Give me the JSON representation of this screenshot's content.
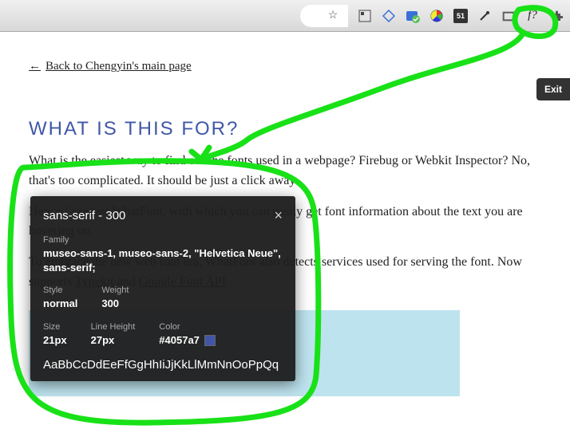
{
  "toolbar": {
    "star_icon": "☆",
    "ext_font": "f?"
  },
  "exit_label": "Exit",
  "back_link": {
    "arrow": "←",
    "text": "Back to Chengyin's main page"
  },
  "heading": "WHAT IS THIS FOR?",
  "para1_a": "What is the easiest way to find out the fonts used in a webpage? Firebug or Webkit Inspector? No, that's too complicated. It should be just a click away.",
  "para2": "Hence I present WhatFont, with which you can easily get font information about the text you are hovering on.",
  "para3_a": "To embrace the new web font era, WhatFont also detects services used for serving the font. Now supports ",
  "para3_link1": "Typekit",
  "para3_b": " and ",
  "para3_link2": "Google Font API",
  "para3_c": ".",
  "tooltip": {
    "title": "sans-serif - 300",
    "labels": {
      "family": "Family",
      "style": "Style",
      "weight": "Weight",
      "size": "Size",
      "lineheight": "Line Height",
      "color": "Color"
    },
    "family": "museo-sans-1, museo-sans-2, \"Helvetica Neue\", sans-serif;",
    "style": "normal",
    "weight": "300",
    "size": "21px",
    "lineheight": "27px",
    "color": "#4057a7",
    "sample": "AaBbCcDdEeFfGgHhIiJjKkLlMmNnOoPpQq"
  }
}
